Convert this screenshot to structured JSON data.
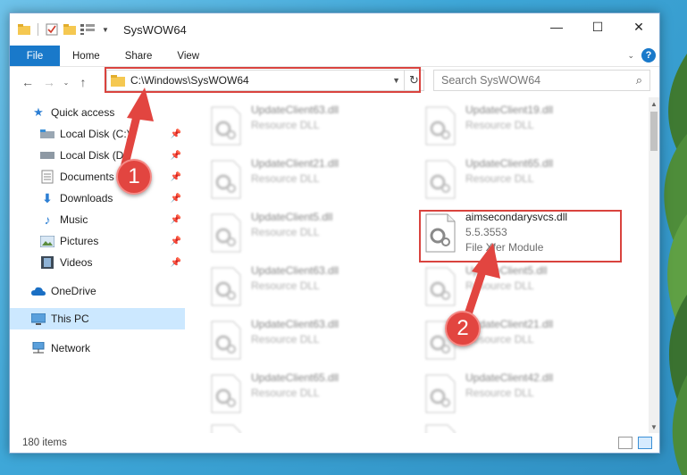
{
  "window": {
    "title": "SysWOW64",
    "controls": {
      "minimize": "—",
      "maximize": "☐",
      "close": "✕"
    }
  },
  "ribbon": {
    "tabs": [
      "File",
      "Home",
      "Share",
      "View"
    ]
  },
  "address": {
    "path": "C:\\Windows\\SysWOW64"
  },
  "search": {
    "placeholder": "Search SysWOW64"
  },
  "sidebar": {
    "items": [
      {
        "label": "Quick access",
        "icon": "star-icon"
      },
      {
        "label": "Local Disk (C:)",
        "icon": "drive-icon"
      },
      {
        "label": "Local Disk (D:)",
        "icon": "drive-icon"
      },
      {
        "label": "Documents",
        "icon": "documents-icon"
      },
      {
        "label": "Downloads",
        "icon": "download-icon"
      },
      {
        "label": "Music",
        "icon": "music-icon"
      },
      {
        "label": "Pictures",
        "icon": "pictures-icon"
      },
      {
        "label": "Videos",
        "icon": "videos-icon"
      },
      {
        "label": "OneDrive",
        "icon": "cloud-icon"
      },
      {
        "label": "This PC",
        "icon": "computer-icon"
      },
      {
        "label": "Network",
        "icon": "network-icon"
      }
    ]
  },
  "files": [
    {
      "name": "UpdateClient63.dll",
      "line2": "Resource DLL",
      "line3": ""
    },
    {
      "name": "UpdateClient19.dll",
      "line2": "Resource DLL",
      "line3": ""
    },
    {
      "name": "UpdateClient21.dll",
      "line2": "Resource DLL",
      "line3": ""
    },
    {
      "name": "UpdateClient65.dll",
      "line2": "Resource DLL",
      "line3": ""
    },
    {
      "name": "UpdateClient5.dll",
      "line2": "Resource DLL",
      "line3": ""
    },
    {
      "name": "aimsecondarysvcs.dll",
      "line2": "5.5.3553",
      "line3": "File Xfer Module"
    },
    {
      "name": "UpdateClient63.dll",
      "line2": "Resource DLL",
      "line3": ""
    },
    {
      "name": "UpdateClient5.dll",
      "line2": "Resource DLL",
      "line3": ""
    },
    {
      "name": "UpdateClient63.dll",
      "line2": "Resource DLL",
      "line3": ""
    },
    {
      "name": "UpdateClient21.dll",
      "line2": "Resource DLL",
      "line3": ""
    },
    {
      "name": "UpdateClient65.dll",
      "line2": "Resource DLL",
      "line3": ""
    },
    {
      "name": "UpdateClient42.dll",
      "line2": "Resource DLL",
      "line3": ""
    },
    {
      "name": "",
      "line2": "",
      "line3": ""
    },
    {
      "name": "",
      "line2": "",
      "line3": ""
    }
  ],
  "status": {
    "count": "180 items"
  },
  "annotations": {
    "step1": "1",
    "step2": "2",
    "color": "#e24540"
  }
}
